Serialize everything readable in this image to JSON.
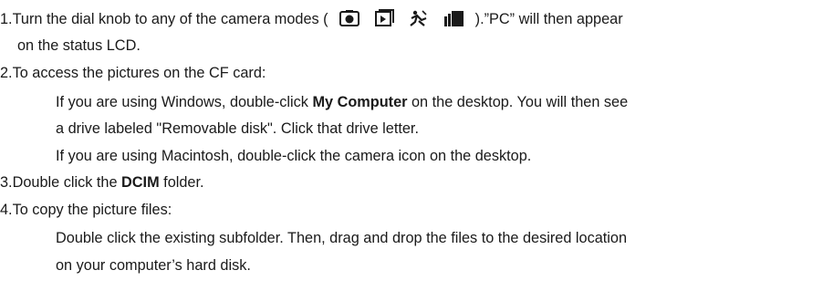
{
  "steps": {
    "s1": {
      "prefix": "1.Turn the dial knob to any of the camera modes ( ",
      "suffix": " ).”PC” will then appear",
      "cont": "on the status LCD.",
      "icons": [
        "camera-mode-icon",
        "playback-mode-icon",
        "scene-mode-icon",
        "continuous-mode-icon"
      ]
    },
    "s2": {
      "title": "2.To access the pictures on the CF card:",
      "win_pre": "If you are using Windows, double-click ",
      "win_bold": "My Computer",
      "win_post": " on the desktop. You will then see",
      "win_cont": "a drive labeled \"Removable disk\". Click that drive letter.",
      "mac": "If you are using Macintosh, double-click the camera icon on the desktop."
    },
    "s3": {
      "pre": "3.Double click the ",
      "bold": "DCIM",
      "post": " folder."
    },
    "s4": {
      "title": "4.To copy the picture files:",
      "line1": "Double click the existing subfolder. Then, drag and drop the files to the desired location",
      "line2": "on your computer’s hard disk."
    }
  }
}
